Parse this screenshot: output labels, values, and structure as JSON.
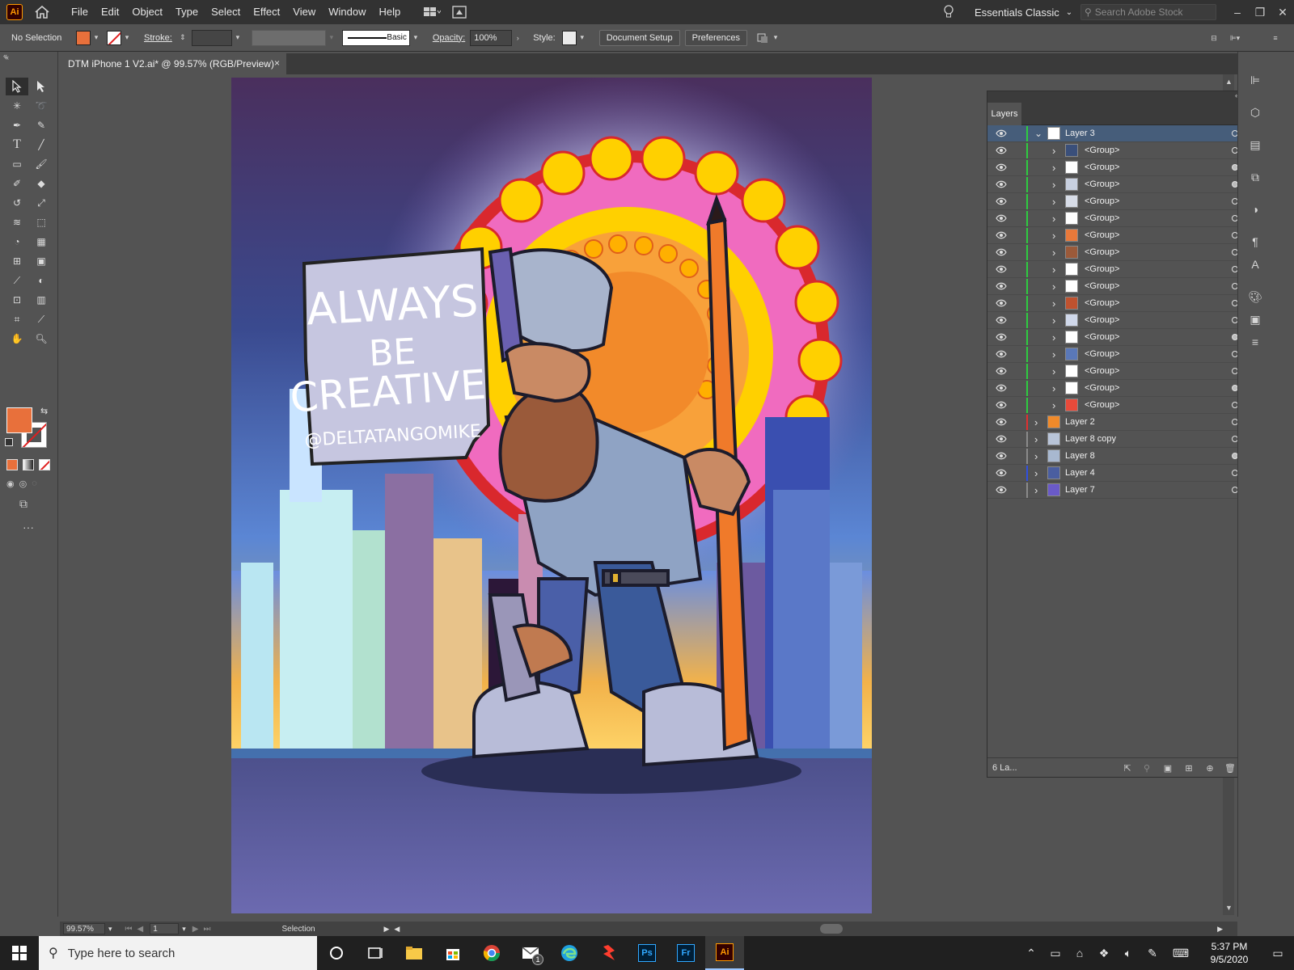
{
  "menubar": {
    "logo": "Ai",
    "menu_items": [
      "File",
      "Edit",
      "Object",
      "Type",
      "Select",
      "Effect",
      "View",
      "Window",
      "Help"
    ],
    "workspace": "Essentials Classic",
    "stock_search_placeholder": "Search Adobe Stock",
    "window_controls": [
      "minimize-icon",
      "restore-icon",
      "close-icon"
    ]
  },
  "controlbar": {
    "selection_status": "No Selection",
    "stroke_label": "Stroke:",
    "brush_label": "Basic",
    "opacity_label": "Opacity:",
    "opacity_value": "100%",
    "style_label": "Style:",
    "document_setup": "Document Setup",
    "preferences": "Preferences",
    "fill_color": "#e8703b"
  },
  "document": {
    "tab_title": "DTM iPhone 1 V2.ai* @ 99.57% (RGB/Preview)",
    "close_glyph": "×"
  },
  "artwork": {
    "sign_line1": "ALWAYS",
    "sign_line2": "BE",
    "sign_line3": "CREATIVE",
    "sign_handle": "@DELTATANGOMIKE"
  },
  "layers": {
    "tab_label": "Layers",
    "rows": [
      {
        "name": "Layer 3",
        "level": 0,
        "expanded": true,
        "selected": true,
        "color": "#2ecc40",
        "thumb": "#ffffff",
        "target_filled": false
      },
      {
        "name": "<Group>",
        "level": 1,
        "color": "#2ecc40",
        "thumb": "#3a4f7a",
        "target_filled": false
      },
      {
        "name": "<Group>",
        "level": 1,
        "color": "#2ecc40",
        "thumb": "#ffffff",
        "target_filled": true
      },
      {
        "name": "<Group>",
        "level": 1,
        "color": "#2ecc40",
        "thumb": "#c8d0e0",
        "target_filled": true
      },
      {
        "name": "<Group>",
        "level": 1,
        "color": "#2ecc40",
        "thumb": "#d8dde8",
        "target_filled": false
      },
      {
        "name": "<Group>",
        "level": 1,
        "color": "#2ecc40",
        "thumb": "#ffffff",
        "target_filled": false
      },
      {
        "name": "<Group>",
        "level": 1,
        "color": "#2ecc40",
        "thumb": "#e9793a",
        "target_filled": false
      },
      {
        "name": "<Group>",
        "level": 1,
        "color": "#2ecc40",
        "thumb": "#9b5a3a",
        "target_filled": false
      },
      {
        "name": "<Group>",
        "level": 1,
        "color": "#2ecc40",
        "thumb": "#ffffff",
        "target_filled": false
      },
      {
        "name": "<Group>",
        "level": 1,
        "color": "#2ecc40",
        "thumb": "#ffffff",
        "target_filled": false
      },
      {
        "name": "<Group>",
        "level": 1,
        "color": "#2ecc40",
        "thumb": "#c0522f",
        "target_filled": false
      },
      {
        "name": "<Group>",
        "level": 1,
        "color": "#2ecc40",
        "thumb": "#d0d8ea",
        "target_filled": false
      },
      {
        "name": "<Group>",
        "level": 1,
        "color": "#2ecc40",
        "thumb": "#ffffff",
        "target_filled": true
      },
      {
        "name": "<Group>",
        "level": 1,
        "color": "#2ecc40",
        "thumb": "#5a78b8",
        "target_filled": false
      },
      {
        "name": "<Group>",
        "level": 1,
        "color": "#2ecc40",
        "thumb": "#ffffff",
        "target_filled": false
      },
      {
        "name": "<Group>",
        "level": 1,
        "color": "#2ecc40",
        "thumb": "#ffffff",
        "target_filled": true
      },
      {
        "name": "<Group>",
        "level": 1,
        "color": "#2ecc40",
        "thumb": "#e84a3a",
        "target_filled": false
      },
      {
        "name": "Layer 2",
        "level": 0,
        "expanded": false,
        "color": "#e03030",
        "thumb": "#f08a2a",
        "target_filled": false
      },
      {
        "name": "Layer 8 copy",
        "level": 0,
        "expanded": false,
        "color": "#8a8a8a",
        "thumb": "#b8c4d8",
        "target_filled": false
      },
      {
        "name": "Layer 8",
        "level": 0,
        "expanded": false,
        "color": "#8a8a8a",
        "thumb": "#a8b8d0",
        "target_filled": true
      },
      {
        "name": "Layer 4",
        "level": 0,
        "expanded": false,
        "color": "#3050e0",
        "thumb": "#4a5ea0",
        "target_filled": false
      },
      {
        "name": "Layer 7",
        "level": 0,
        "expanded": false,
        "color": "#8a8a8a",
        "thumb": "#6a5ac8",
        "target_filled": false
      }
    ],
    "count_label": "6 La..."
  },
  "statusbar": {
    "zoom": "99.57%",
    "artboard_number": "1",
    "tool_status": "Selection"
  },
  "taskbar": {
    "search_placeholder": "Type here to search",
    "mail_badge": "1",
    "time": "5:37 PM",
    "date": "9/5/2020",
    "apps": [
      "cortana-icon",
      "task-view-icon",
      "file-explorer-icon",
      "store-icon",
      "chrome-icon",
      "mail-icon",
      "edge-icon",
      "app-icon",
      "photoshop-icon",
      "fresco-icon",
      "illustrator-icon"
    ]
  }
}
